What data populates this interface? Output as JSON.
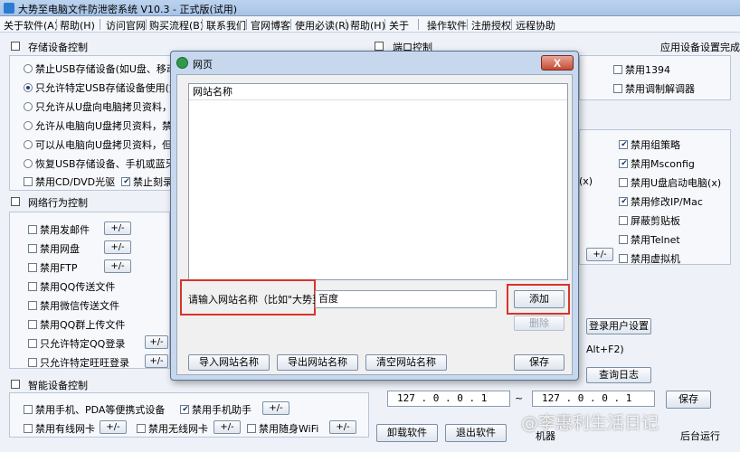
{
  "window": {
    "title": "大势至电脑文件防泄密系统 V10.3 - 正式版(试用)"
  },
  "menu": [
    "关于软件(A)",
    "帮助(H)",
    "访问官网",
    "购买流程(B)",
    "联系我们",
    "官网博客",
    "使用必读(R)",
    "帮助(H)",
    "关于",
    "操作软件",
    "注册授权",
    "远程协助"
  ],
  "storage": {
    "heading": "存储设备控制",
    "options": [
      "禁止USB存储设备(如U盘、移动硬盘",
      "只允许特定USB存储设备使用(如U盘",
      "只允许从U盘向电脑拷贝资料，禁止",
      "允许从电脑向U盘拷贝资料，禁止U盘",
      "可以从电脑向U盘拷贝资料，但必须",
      "恢复USB存储设备、手机或蓝牙等设"
    ],
    "cd_label": "禁用CD/DVD光驱",
    "burn_label": "禁止刻录"
  },
  "port": {
    "heading": "端口控制",
    "status": "应用设备设置完成",
    "items": [
      "禁用1394",
      "禁用调制解调器"
    ]
  },
  "network": {
    "heading": "网络行为控制",
    "items": [
      "禁用发邮件",
      "禁用网盘",
      "禁用FTP",
      "禁用QQ传送文件",
      "禁用微信传送文件",
      "禁用QQ群上传文件",
      "只允许特定QQ登录",
      "只允许特定旺旺登录"
    ],
    "toggle": "+/-"
  },
  "right_options": {
    "items": [
      "禁用组策略",
      "禁用Msconfig",
      "禁用U盘启动电脑(x)",
      "禁用修改IP/Mac",
      "屏蔽剪贴板",
      "禁用Telnet",
      "禁用虚拟机"
    ],
    "checked": [
      true,
      true,
      false,
      true,
      false,
      false,
      false
    ],
    "partial_x": "(x)",
    "toggle": "+/-"
  },
  "smart": {
    "heading": "智能设备控制",
    "row1": [
      "禁用手机、PDA等便携式设备",
      "禁用手机助手"
    ],
    "row2": [
      "禁用有线网卡",
      "禁用无线网卡",
      "禁用随身WiFi"
    ],
    "toggle": "+/-"
  },
  "users": {
    "login_btn": "登录用户设置",
    "hotkey": "Alt+F2)",
    "log_btn": "查询日志",
    "ip_start": "127 .  0 .  0 .  1",
    "ip_sep": "~",
    "ip_end": "127 .  0 .  0 .  1",
    "save": "保存",
    "uninstall": "卸载软件",
    "exit": "退出软件",
    "machine": "机器",
    "extra": "后台运行"
  },
  "dialog": {
    "title": "网页",
    "close": "X",
    "list_header": "网站名称",
    "input_label": "请输入网站名称（比如\"大势至\"）",
    "input_value": "百度",
    "add": "添加",
    "delete": "删除",
    "import": "导入网站名称",
    "export": "导出网站名称",
    "clear": "清空网站名称",
    "save": "保存"
  },
  "watermark": "@李惠利生活日记",
  "colors": {
    "highlight": "#d9332b",
    "titlebar": "#bcd3ee"
  }
}
